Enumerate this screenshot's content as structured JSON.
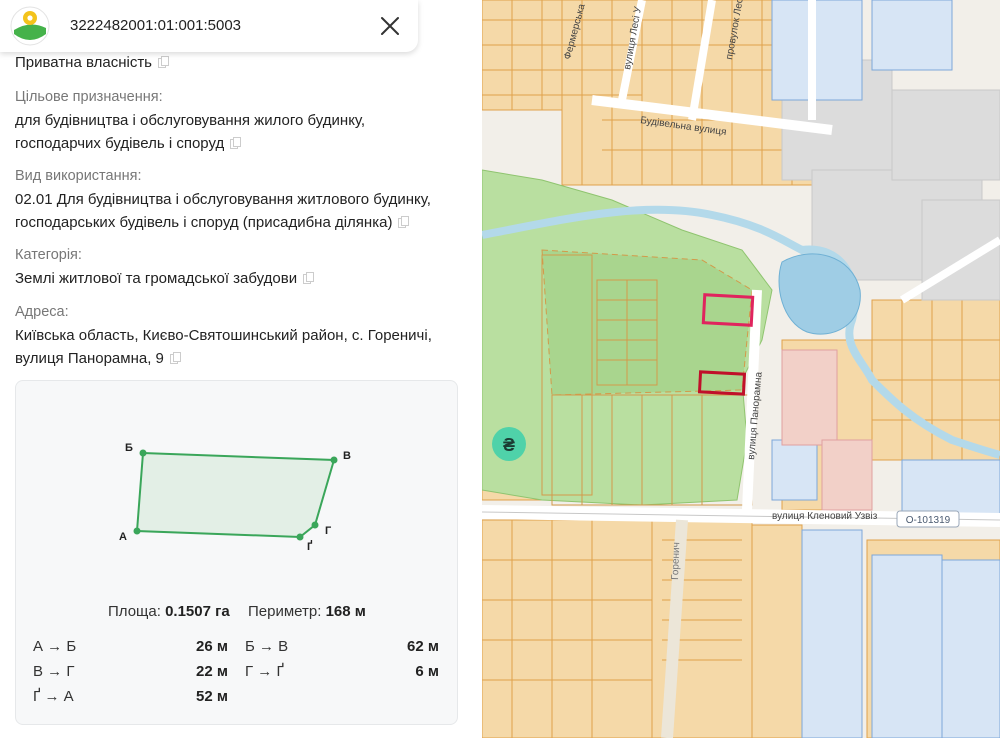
{
  "header": {
    "cadastral_number": "3222482001:01:001:5003",
    "logo": "map-logo-icon",
    "close": "close-icon"
  },
  "ownership": {
    "value": "Приватна власність"
  },
  "purpose": {
    "label": "Цільове призначення:",
    "line1": "для будівництва і обслуговування жилого будинку,",
    "line2": "господарчих будівель і споруд"
  },
  "usage": {
    "label": "Вид використання:",
    "line1": "02.01 Для будівництва і обслуговування житлового будинку,",
    "line2": "господарських будівель і споруд (присадибна ділянка)"
  },
  "category": {
    "label": "Категорія:",
    "value": "Землі житлової та громадської забудови"
  },
  "address": {
    "label": "Адреса:",
    "line1": "Київська область, Києво-Святошинський район, с. Гореничі,",
    "line2": "вулиця Панорамна, 9"
  },
  "parcel": {
    "vertices": {
      "a": "А",
      "b": "Б",
      "v": "В",
      "g": "Г",
      "gg": "Ґ"
    },
    "area_label": "Площа:",
    "area_value": "0.1507 га",
    "perimeter_label": "Периметр:",
    "perimeter_value": "168 м",
    "edges": [
      {
        "name": "А → Б",
        "length": "26 м"
      },
      {
        "name": "Б → В",
        "length": "62 м"
      },
      {
        "name": "В → Г",
        "length": "22 м"
      },
      {
        "name": "Г → Ґ",
        "length": "6 м"
      },
      {
        "name": "Ґ → А",
        "length": "52 м"
      }
    ]
  },
  "map": {
    "streets": {
      "budivelna": "Будівельна вулиця",
      "panoramna": "вулиця Панорамна",
      "klenovyi": "вулиця Кленовий Узвіз",
      "fermerska": "Фермерська",
      "lesi": "вулиця Лесі У",
      "provulok": "провулок Лес",
      "gorenich": "Горенич"
    },
    "road_badge": "О-101319",
    "currency_icon": "₴"
  },
  "colors": {
    "accent_green": "#3aa65a",
    "parcel_selected": "#e0245e",
    "parcel_dark": "#c0102a",
    "map_orange": "#f5d9a8"
  }
}
